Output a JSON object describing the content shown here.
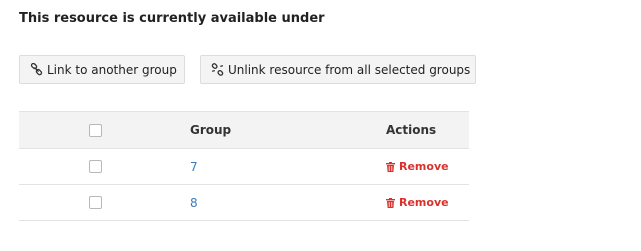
{
  "heading": "This resource is currently available under",
  "buttons": {
    "link": {
      "label": "Link to another group",
      "icon": "link-icon"
    },
    "unlink": {
      "label": "Unlink resource from all selected groups",
      "icon": "unlink-icon"
    }
  },
  "table": {
    "columns": {
      "group": "Group",
      "actions": "Actions"
    },
    "rows": [
      {
        "group": "7",
        "action": "Remove",
        "action_icon": "trash-icon"
      },
      {
        "group": "8",
        "action": "Remove",
        "action_icon": "trash-icon"
      }
    ]
  },
  "colors": {
    "link": "#3a7cb8",
    "danger": "#d9322e",
    "header_bg": "#f3f3f3",
    "button_bg": "#f4f4f4"
  }
}
